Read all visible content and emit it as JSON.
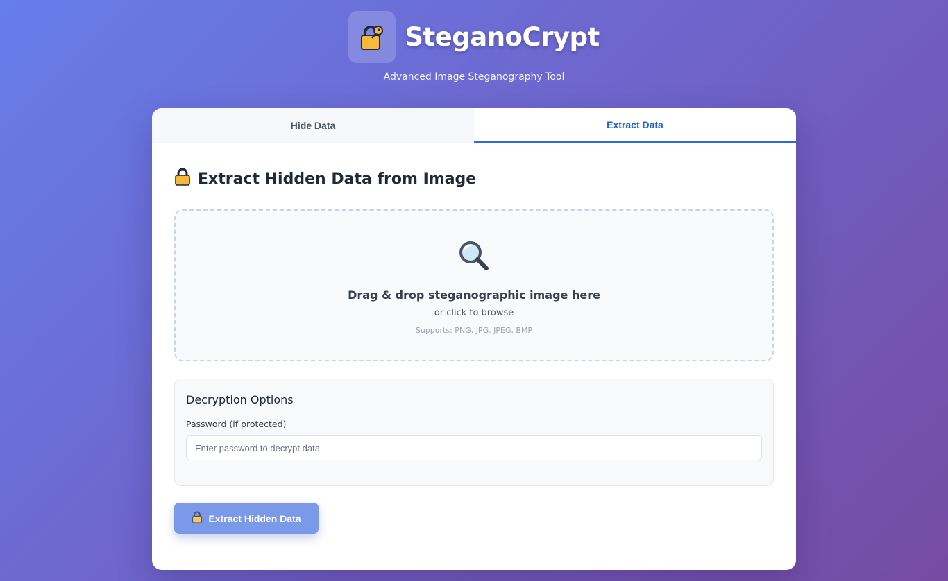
{
  "header": {
    "app_title": "SteganoCrypt",
    "subtitle": "Advanced Image Steganography Tool",
    "logo_icon": "lock-with-key-icon"
  },
  "tabs": [
    {
      "label": "Hide Data",
      "active": false
    },
    {
      "label": "Extract Data",
      "active": true
    }
  ],
  "main": {
    "section_title": "Extract Hidden Data from Image",
    "section_icon": "lock-icon",
    "dropzone": {
      "icon": "magnifier-icon",
      "title": "Drag & drop steganographic image here",
      "subtitle": "or click to browse",
      "supports": "Supports: PNG, JPG, JPEG, BMP"
    },
    "options": {
      "title": "Decryption Options",
      "password_label": "Password (if protected)",
      "password_placeholder": "Enter password to decrypt data",
      "password_value": ""
    },
    "extract_button": {
      "label": "Extract Hidden Data",
      "icon": "lock-icon"
    }
  },
  "colors": {
    "gradient_start": "#667eea",
    "gradient_end": "#764ba2",
    "accent": "#2f6bd8",
    "button_bg": "#7a9ae9"
  }
}
